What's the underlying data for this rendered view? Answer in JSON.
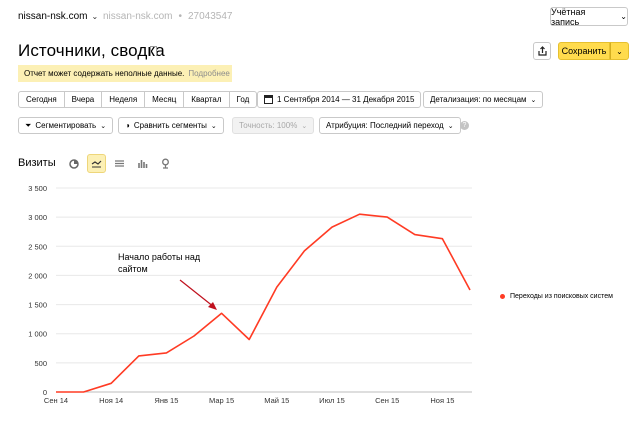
{
  "header": {
    "site": "nissan-nsk.com",
    "site_ghost": "nissan-nsk.com",
    "counter_id": "27043547",
    "account_label": "Учётная запись"
  },
  "page": {
    "title": "Источники, сводка",
    "save_label": "Сохранить"
  },
  "warning": {
    "text": "Отчет может содержать неполные данные.",
    "more": "Подробнее"
  },
  "periods": [
    "Сегодня",
    "Вчера",
    "Неделя",
    "Месяц",
    "Квартал",
    "Год"
  ],
  "controls": {
    "date_range": "1 Сентября 2014 — 31 Декабря 2015",
    "detail": "Детализация: по месяцам",
    "segment": "Сегментировать",
    "compare": "Сравнить сегменты",
    "accuracy": "Точность: 100%",
    "attribution": "Атрибуция: Последний переход",
    "help": "?"
  },
  "metric": {
    "title": "Визиты",
    "chart_type_icons": [
      "pie-chart-icon",
      "line-chart-icon",
      "area-chart-icon",
      "bar-chart-icon",
      "map-pin-icon"
    ]
  },
  "annotation": "Начало работы над сайтом",
  "chart_data": {
    "type": "line",
    "x": [
      "Сен 14",
      "Окт 14",
      "Ноя 14",
      "Дек 14",
      "Янв 15",
      "Фев 15",
      "Мар 15",
      "Апр 15",
      "Май 15",
      "Июн 15",
      "Июл 15",
      "Авг 15",
      "Сен 15",
      "Окт 15",
      "Ноя 15",
      "Дек 15"
    ],
    "x_tick_labels": [
      "Сен 14",
      "Ноя 14",
      "Янв 15",
      "Мар 15",
      "Май 15",
      "Июл 15",
      "Сен 15",
      "Ноя 15"
    ],
    "y_tick_labels": [
      "0",
      "500",
      "1 000",
      "1 500",
      "2 000",
      "2 500",
      "3 000",
      "3 500"
    ],
    "ylim": [
      0,
      3500
    ],
    "grid": true,
    "legend_position": "right",
    "series": [
      {
        "name": "Переходы из поисковых систем",
        "color": "#ff3b24",
        "values": [
          0,
          0,
          150,
          620,
          670,
          960,
          1350,
          900,
          1800,
          2420,
          2830,
          3050,
          3000,
          2700,
          2630,
          1750
        ]
      }
    ]
  }
}
